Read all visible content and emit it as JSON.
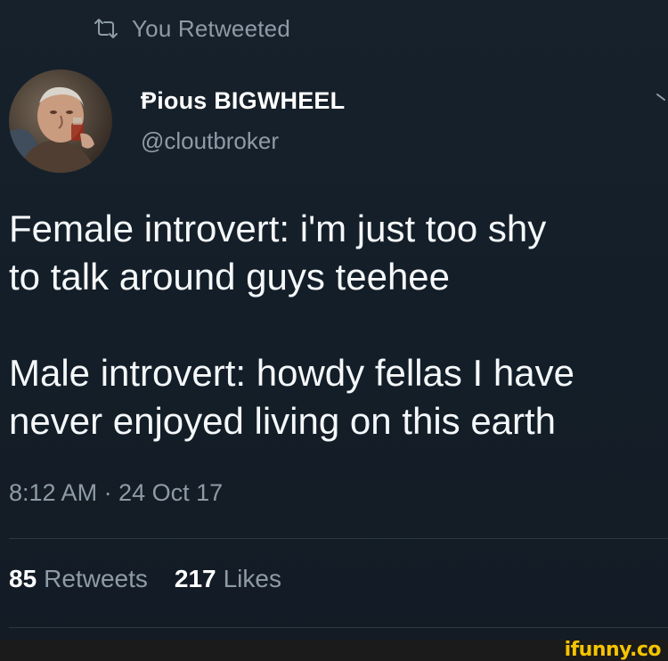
{
  "retweet_header": {
    "icon": "retweet-icon",
    "text": "You Retweeted"
  },
  "user": {
    "avatar": "avatar-photo",
    "name": "Ᵽious BIGWHEEL",
    "handle": "@cloutbroker"
  },
  "tweet": {
    "paragraphs": [
      "Female introvert: i'm just too shy\nto talk around guys teehee",
      "Male introvert: howdy fellas I have\nnever enjoyed living on this earth"
    ],
    "line1": "Female introvert: i'm just too shy",
    "line2": "to talk around guys teehee",
    "line3": "Male introvert: howdy fellas I have",
    "line4": "never enjoyed living on this earth"
  },
  "timestamp": "8:12 AM · 24 Oct 17",
  "stats": {
    "retweets_count": "85",
    "retweets_label": "Retweets",
    "likes_count": "217",
    "likes_label": "Likes"
  },
  "watermark": "ifunny.co",
  "colors": {
    "background": "#141d26",
    "secondary_text": "#8e9ba7",
    "primary_text": "#ffffff",
    "watermark": "#f5c400"
  }
}
